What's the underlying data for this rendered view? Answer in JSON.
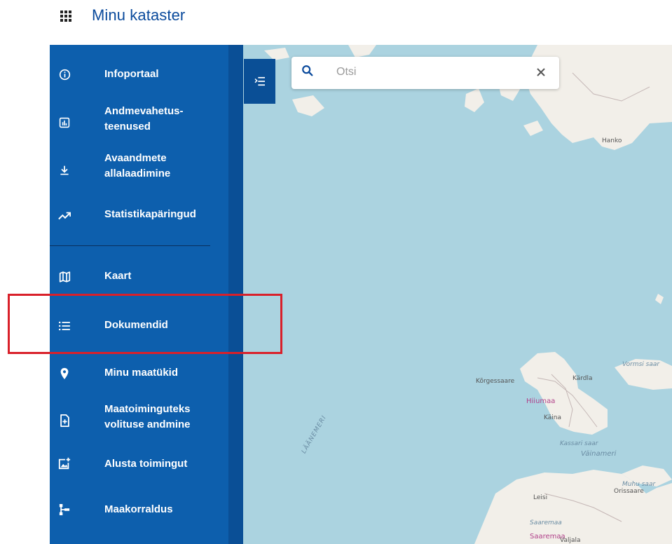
{
  "header": {
    "title": "Minu kataster",
    "apps_icon": "apps-grid-icon"
  },
  "sidebar": {
    "items": [
      {
        "label": "Infoportaal",
        "icon": "info-icon"
      },
      {
        "label": "Andmevahetus-\nteenused",
        "icon": "chart-icon"
      },
      {
        "label": "Avaandmete\nallalaadimine",
        "icon": "download-icon"
      },
      {
        "label": "Statistikapäringud",
        "icon": "trending-up-icon"
      },
      {
        "label": "Kaart",
        "icon": "map-icon"
      },
      {
        "label": "Dokumendid",
        "icon": "list-icon"
      },
      {
        "label": "Minu maatükid",
        "icon": "location-pin-icon"
      },
      {
        "label": "Maatoiminguteks\nvolituse andmine",
        "icon": "document-add-icon"
      },
      {
        "label": "Alusta toimingut",
        "icon": "add-photo-icon"
      },
      {
        "label": "Maakorraldus",
        "icon": "hierarchy-icon"
      }
    ]
  },
  "search": {
    "placeholder": "Otsi",
    "value": ""
  },
  "map": {
    "labels": {
      "hanko": "Hanko",
      "kardla": "Kärdla",
      "korgessaare": "Kõrgessaare",
      "hiiumaa": "Hiiumaa",
      "kaina": "Käina",
      "kassari": "Kassari saar",
      "vainameri": "Väinameri",
      "vormsi": "Vormsi saar",
      "muhu": "Muhu saar",
      "orissaare": "Orissaare",
      "leisi": "Leisi",
      "saaremaa1": "Saaremaa",
      "saaremaa2": "Saaremaa",
      "valjala": "Valjala",
      "laanemeri": "LÄÄNEMERI"
    },
    "colors": {
      "water": "#abd3e0",
      "land": "#f2efe9",
      "region_label": "#b1418a"
    }
  },
  "colors": {
    "sidebar": "#0d5fad",
    "accent": "#0a4a9c",
    "highlight": "#d9202a"
  }
}
